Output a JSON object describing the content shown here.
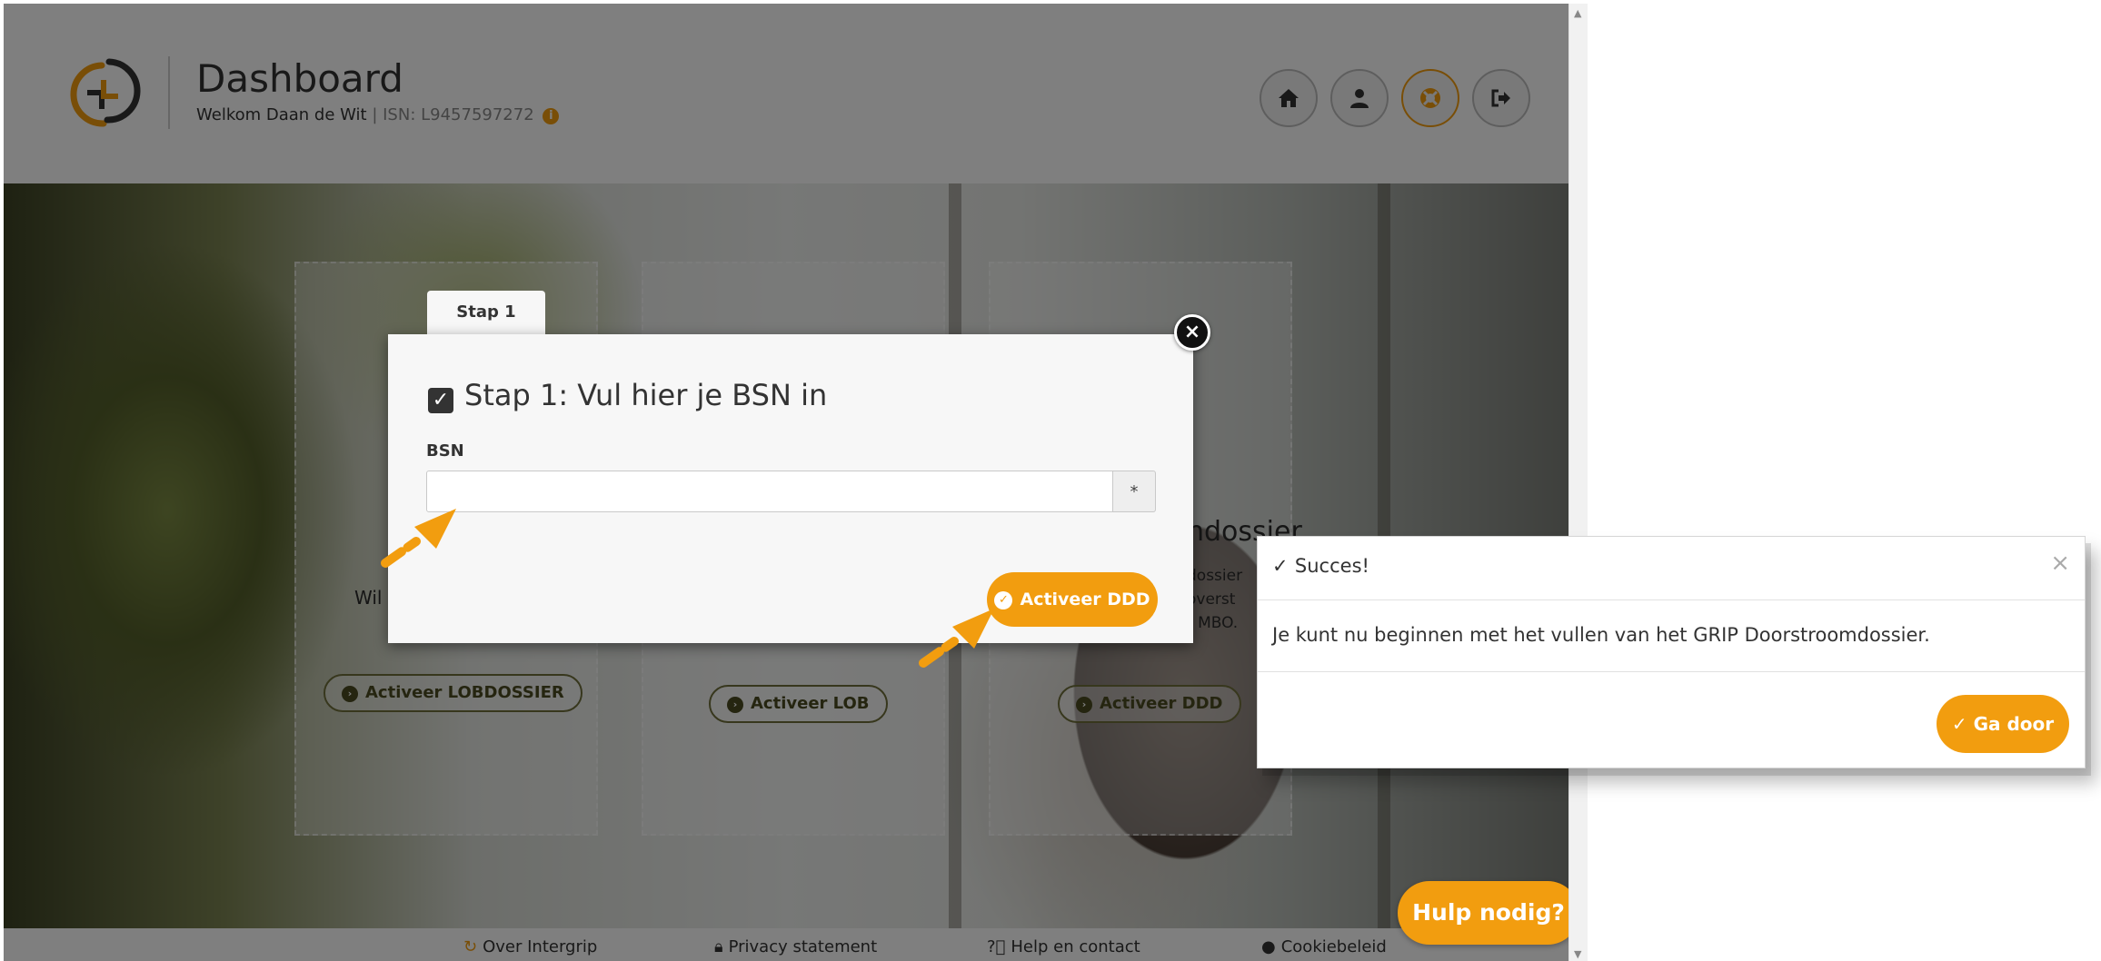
{
  "header": {
    "title": "Dashboard",
    "welcome": "Welkom Daan de Wit",
    "isn": " | ISN: L9457597272",
    "info_icon": "i",
    "nav": [
      {
        "name": "home",
        "icon": "home-icon"
      },
      {
        "name": "profile",
        "icon": "user-icon"
      },
      {
        "name": "help",
        "icon": "lifebuoy-icon"
      },
      {
        "name": "logout",
        "icon": "sign-out-icon"
      }
    ]
  },
  "cards": {
    "lob_text_partial": "Wil",
    "card1_button": "Activeer LOBDOSSIER",
    "card2_button": "Activeer LOB",
    "card3_title_partial": "ndossier",
    "card3_text_line1": "dossier",
    "card3_text_line2": "overst",
    "card3_text_line3": "t MBO.",
    "card3_button": "Activeer DDD"
  },
  "footer": {
    "links": [
      "Over Intergrip",
      "Privacy statement",
      "Help en contact",
      "Cookiebeleid"
    ]
  },
  "help_button": "Hulp nodig?",
  "modal": {
    "tab": "Stap 1",
    "title": "Stap 1: Vul hier je BSN in",
    "bsn_label": "BSN",
    "bsn_value": "",
    "bsn_required": "*",
    "activate_button": "Activeer DDD",
    "close_symbol": "×"
  },
  "toast": {
    "title": "Succes!",
    "message": "Je kunt nu beginnen met het vullen van het GRIP Doorstroomdossier.",
    "close_symbol": "×",
    "continue_button": "Ga door"
  },
  "colors": {
    "accent": "#f29d0f",
    "overlay": "rgba(0,0,0,0.5)"
  }
}
